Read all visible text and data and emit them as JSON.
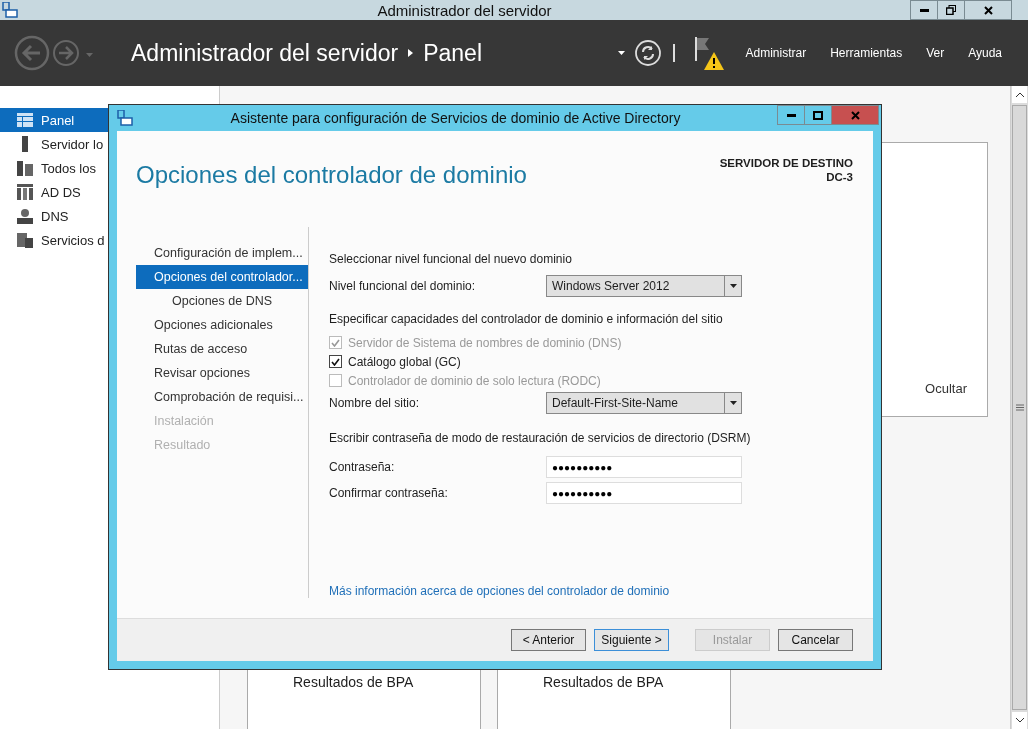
{
  "window": {
    "title": "Administrador del servidor"
  },
  "header": {
    "breadcrumb": [
      "Administrador del servidor",
      "Panel"
    ],
    "menu": [
      "Administrar",
      "Herramientas",
      "Ver",
      "Ayuda"
    ]
  },
  "sidebar": {
    "items": [
      {
        "label": "Panel",
        "selected": true
      },
      {
        "label": "Servidor lo",
        "selected": false
      },
      {
        "label": "Todos los",
        "selected": false
      },
      {
        "label": "AD DS",
        "selected": false
      },
      {
        "label": "DNS",
        "selected": false
      },
      {
        "label": "Servicios d",
        "selected": false
      }
    ]
  },
  "dashboard": {
    "hide_label": "Ocultar",
    "cards": [
      "Resultados de BPA",
      "Resultados de BPA"
    ]
  },
  "dialog": {
    "title": "Asistente para configuración de Servicios de dominio de Active Directory",
    "heading": "Opciones del controlador de dominio",
    "target_label": "SERVIDOR DE DESTINO",
    "target_server": "DC-3",
    "nav": [
      {
        "label": "Configuración de implem...",
        "selected": false,
        "disabled": false
      },
      {
        "label": "Opciones del controlador...",
        "selected": true,
        "disabled": false,
        "children": [
          {
            "label": "Opciones de DNS",
            "selected": false,
            "disabled": false
          }
        ]
      },
      {
        "label": "Opciones adicionales",
        "selected": false,
        "disabled": false
      },
      {
        "label": "Rutas de acceso",
        "selected": false,
        "disabled": false
      },
      {
        "label": "Revisar opciones",
        "selected": false,
        "disabled": false
      },
      {
        "label": "Comprobación de requisi...",
        "selected": false,
        "disabled": false
      },
      {
        "label": "Instalación",
        "selected": false,
        "disabled": true
      },
      {
        "label": "Resultado",
        "selected": false,
        "disabled": true
      }
    ],
    "functional_level": {
      "heading": "Seleccionar nivel funcional del nuevo dominio",
      "label": "Nivel funcional del dominio:",
      "value": "Windows Server 2012"
    },
    "capabilities": {
      "heading": "Especificar capacidades del controlador de dominio e información del sitio",
      "options": [
        {
          "label": "Servidor de Sistema de nombres de dominio (DNS)",
          "checked": true,
          "disabled": true
        },
        {
          "label": "Catálogo global (GC)",
          "checked": true,
          "disabled": false
        },
        {
          "label": "Controlador de dominio de solo lectura (RODC)",
          "checked": false,
          "disabled": true
        }
      ],
      "site": {
        "label": "Nombre del sitio:",
        "value": "Default-First-Site-Name"
      }
    },
    "dsrm": {
      "heading": "Escribir contraseña de modo de restauración de servicios de directorio (DSRM)",
      "fields": [
        {
          "label": "Contraseña:",
          "value": "●●●●●●●●●●"
        },
        {
          "label": "Confirmar contraseña:",
          "value": "●●●●●●●●●●"
        }
      ]
    },
    "link": "Más información acerca de opciones del controlador de dominio",
    "buttons": [
      {
        "label": "< Anterior",
        "default": false,
        "disabled": false
      },
      {
        "label": "Siguiente >",
        "default": true,
        "disabled": false
      },
      {
        "label": "Instalar",
        "default": false,
        "disabled": true
      },
      {
        "label": "Cancelar",
        "default": false,
        "disabled": false
      }
    ]
  }
}
